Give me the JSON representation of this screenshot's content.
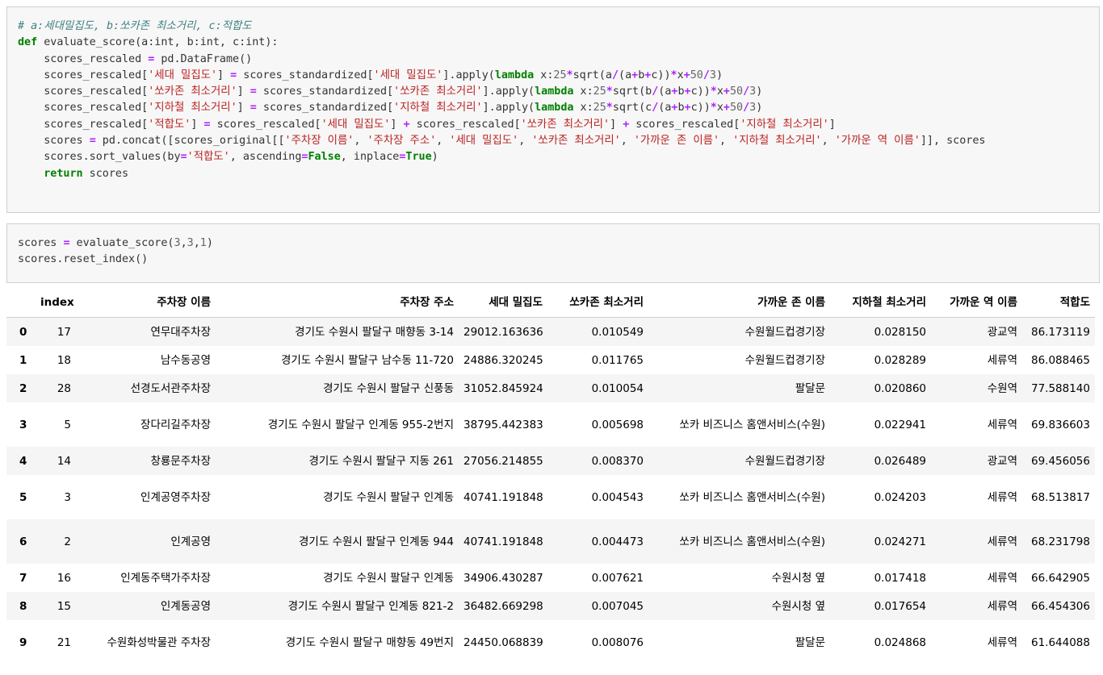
{
  "cell1": {
    "lines": [
      [
        {
          "t": "cm",
          "v": "# a:세대밀집도, b:쏘카존 최소거리, c:적합도"
        }
      ],
      [
        {
          "t": "kw",
          "v": "def"
        },
        {
          "t": "pl",
          "v": " evaluate_score(a:int, b:int, c:int):"
        }
      ],
      [
        {
          "t": "pl",
          "v": "    scores_rescaled "
        },
        {
          "t": "op",
          "v": "="
        },
        {
          "t": "pl",
          "v": " pd.DataFrame()"
        }
      ],
      [
        {
          "t": "pl",
          "v": "    scores_rescaled["
        },
        {
          "t": "st",
          "v": "'세대 밀집도'"
        },
        {
          "t": "pl",
          "v": "] "
        },
        {
          "t": "op",
          "v": "="
        },
        {
          "t": "pl",
          "v": " scores_standardized["
        },
        {
          "t": "st",
          "v": "'세대 밀집도'"
        },
        {
          "t": "pl",
          "v": "].apply("
        },
        {
          "t": "kw",
          "v": "lambda"
        },
        {
          "t": "pl",
          "v": " x:"
        },
        {
          "t": "nu",
          "v": "25"
        },
        {
          "t": "op",
          "v": "*"
        },
        {
          "t": "pl",
          "v": "sqrt(a"
        },
        {
          "t": "op",
          "v": "/"
        },
        {
          "t": "pl",
          "v": "(a"
        },
        {
          "t": "op",
          "v": "+"
        },
        {
          "t": "pl",
          "v": "b"
        },
        {
          "t": "op",
          "v": "+"
        },
        {
          "t": "pl",
          "v": "c))"
        },
        {
          "t": "op",
          "v": "*"
        },
        {
          "t": "pl",
          "v": "x"
        },
        {
          "t": "op",
          "v": "+"
        },
        {
          "t": "nu",
          "v": "50"
        },
        {
          "t": "op",
          "v": "/"
        },
        {
          "t": "nu",
          "v": "3"
        },
        {
          "t": "pl",
          "v": ")"
        }
      ],
      [
        {
          "t": "pl",
          "v": "    scores_rescaled["
        },
        {
          "t": "st",
          "v": "'쏘카존 최소거리'"
        },
        {
          "t": "pl",
          "v": "] "
        },
        {
          "t": "op",
          "v": "="
        },
        {
          "t": "pl",
          "v": " scores_standardized["
        },
        {
          "t": "st",
          "v": "'쏘카존 최소거리'"
        },
        {
          "t": "pl",
          "v": "].apply("
        },
        {
          "t": "kw",
          "v": "lambda"
        },
        {
          "t": "pl",
          "v": " x:"
        },
        {
          "t": "nu",
          "v": "25"
        },
        {
          "t": "op",
          "v": "*"
        },
        {
          "t": "pl",
          "v": "sqrt(b"
        },
        {
          "t": "op",
          "v": "/"
        },
        {
          "t": "pl",
          "v": "(a"
        },
        {
          "t": "op",
          "v": "+"
        },
        {
          "t": "pl",
          "v": "b"
        },
        {
          "t": "op",
          "v": "+"
        },
        {
          "t": "pl",
          "v": "c))"
        },
        {
          "t": "op",
          "v": "*"
        },
        {
          "t": "pl",
          "v": "x"
        },
        {
          "t": "op",
          "v": "+"
        },
        {
          "t": "nu",
          "v": "50"
        },
        {
          "t": "op",
          "v": "/"
        },
        {
          "t": "nu",
          "v": "3"
        },
        {
          "t": "pl",
          "v": ")"
        }
      ],
      [
        {
          "t": "pl",
          "v": "    scores_rescaled["
        },
        {
          "t": "st",
          "v": "'지하철 최소거리'"
        },
        {
          "t": "pl",
          "v": "] "
        },
        {
          "t": "op",
          "v": "="
        },
        {
          "t": "pl",
          "v": " scores_standardized["
        },
        {
          "t": "st",
          "v": "'지하철 최소거리'"
        },
        {
          "t": "pl",
          "v": "].apply("
        },
        {
          "t": "kw",
          "v": "lambda"
        },
        {
          "t": "pl",
          "v": " x:"
        },
        {
          "t": "nu",
          "v": "25"
        },
        {
          "t": "op",
          "v": "*"
        },
        {
          "t": "pl",
          "v": "sqrt(c"
        },
        {
          "t": "op",
          "v": "/"
        },
        {
          "t": "pl",
          "v": "(a"
        },
        {
          "t": "op",
          "v": "+"
        },
        {
          "t": "pl",
          "v": "b"
        },
        {
          "t": "op",
          "v": "+"
        },
        {
          "t": "pl",
          "v": "c))"
        },
        {
          "t": "op",
          "v": "*"
        },
        {
          "t": "pl",
          "v": "x"
        },
        {
          "t": "op",
          "v": "+"
        },
        {
          "t": "nu",
          "v": "50"
        },
        {
          "t": "op",
          "v": "/"
        },
        {
          "t": "nu",
          "v": "3"
        },
        {
          "t": "pl",
          "v": ")"
        }
      ],
      [
        {
          "t": "pl",
          "v": "    scores_rescaled["
        },
        {
          "t": "st",
          "v": "'적합도'"
        },
        {
          "t": "pl",
          "v": "] "
        },
        {
          "t": "op",
          "v": "="
        },
        {
          "t": "pl",
          "v": " scores_rescaled["
        },
        {
          "t": "st",
          "v": "'세대 밀집도'"
        },
        {
          "t": "pl",
          "v": "] "
        },
        {
          "t": "op",
          "v": "+"
        },
        {
          "t": "pl",
          "v": " scores_rescaled["
        },
        {
          "t": "st",
          "v": "'쏘카존 최소거리'"
        },
        {
          "t": "pl",
          "v": "] "
        },
        {
          "t": "op",
          "v": "+"
        },
        {
          "t": "pl",
          "v": " scores_rescaled["
        },
        {
          "t": "st",
          "v": "'지하철 최소거리'"
        },
        {
          "t": "pl",
          "v": "]"
        }
      ],
      [
        {
          "t": "pl",
          "v": "    scores "
        },
        {
          "t": "op",
          "v": "="
        },
        {
          "t": "pl",
          "v": " pd.concat([scores_original[["
        },
        {
          "t": "st",
          "v": "'주차장 이름'"
        },
        {
          "t": "pl",
          "v": ", "
        },
        {
          "t": "st",
          "v": "'주차장 주소'"
        },
        {
          "t": "pl",
          "v": ", "
        },
        {
          "t": "st",
          "v": "'세대 밀집도'"
        },
        {
          "t": "pl",
          "v": ", "
        },
        {
          "t": "st",
          "v": "'쏘카존 최소거리'"
        },
        {
          "t": "pl",
          "v": ", "
        },
        {
          "t": "st",
          "v": "'가까운 존 이름'"
        },
        {
          "t": "pl",
          "v": ", "
        },
        {
          "t": "st",
          "v": "'지하철 최소거리'"
        },
        {
          "t": "pl",
          "v": ", "
        },
        {
          "t": "st",
          "v": "'가까운 역 이름'"
        },
        {
          "t": "pl",
          "v": "]], scores"
        }
      ],
      [
        {
          "t": "pl",
          "v": "    scores.sort_values(by"
        },
        {
          "t": "op",
          "v": "="
        },
        {
          "t": "st",
          "v": "'적합도'"
        },
        {
          "t": "pl",
          "v": ", ascending"
        },
        {
          "t": "op",
          "v": "="
        },
        {
          "t": "kw",
          "v": "False"
        },
        {
          "t": "pl",
          "v": ", inplace"
        },
        {
          "t": "op",
          "v": "="
        },
        {
          "t": "kw",
          "v": "True"
        },
        {
          "t": "pl",
          "v": ")"
        }
      ],
      [
        {
          "t": "pl",
          "v": "    "
        },
        {
          "t": "kw",
          "v": "return"
        },
        {
          "t": "pl",
          "v": " scores"
        }
      ]
    ]
  },
  "cell2": {
    "lines": [
      [
        {
          "t": "pl",
          "v": "scores "
        },
        {
          "t": "op",
          "v": "="
        },
        {
          "t": "pl",
          "v": " evaluate_score("
        },
        {
          "t": "nu",
          "v": "3"
        },
        {
          "t": "pl",
          "v": ","
        },
        {
          "t": "nu",
          "v": "3"
        },
        {
          "t": "pl",
          "v": ","
        },
        {
          "t": "nu",
          "v": "1"
        },
        {
          "t": "pl",
          "v": ")"
        }
      ],
      [
        {
          "t": "pl",
          "v": "scores.reset_index()"
        }
      ]
    ]
  },
  "table": {
    "headers": [
      "",
      "index",
      "주차장 이름",
      "주차장 주소",
      "세대 밀집도",
      "쏘카존 최소거리",
      "가까운 존 이름",
      "지하철 최소거리",
      "가까운 역 이름",
      "적합도"
    ],
    "rows": [
      [
        "0",
        "17",
        "연무대주차장",
        "경기도 수원시 팔달구 매향동 3-14",
        "29012.163636",
        "0.010549",
        "수원월드컵경기장",
        "0.028150",
        "광교역",
        "86.173119"
      ],
      [
        "1",
        "18",
        "남수동공영",
        "경기도 수원시 팔달구 남수동 11-720",
        "24886.320245",
        "0.011765",
        "수원월드컵경기장",
        "0.028289",
        "세류역",
        "86.088465"
      ],
      [
        "2",
        "28",
        "선경도서관주차장",
        "경기도 수원시 팔달구 신풍동",
        "31052.845924",
        "0.010054",
        "팔달문",
        "0.020860",
        "수원역",
        "77.588140"
      ],
      [
        "3",
        "5",
        "장다리길주차장",
        "경기도 수원시 팔달구 인계동 955-2번지",
        "38795.442383",
        "0.005698",
        "쏘카 비즈니스 홈앤서비스(수원)",
        "0.022941",
        "세류역",
        "69.836603"
      ],
      [
        "4",
        "14",
        "창룡문주차장",
        "경기도 수원시 팔달구 지동 261",
        "27056.214855",
        "0.008370",
        "수원월드컵경기장",
        "0.026489",
        "광교역",
        "69.456056"
      ],
      [
        "5",
        "3",
        "인계공영주차장",
        "경기도 수원시 팔달구 인계동",
        "40741.191848",
        "0.004543",
        "쏘카 비즈니스 홈앤서비스(수원)",
        "0.024203",
        "세류역",
        "68.513817"
      ],
      [
        "6",
        "2",
        "인계공영",
        "경기도 수원시 팔달구 인계동 944",
        "40741.191848",
        "0.004473",
        "쏘카 비즈니스 홈앤서비스(수원)",
        "0.024271",
        "세류역",
        "68.231798"
      ],
      [
        "7",
        "16",
        "인계동주택가주차장",
        "경기도 수원시 팔달구 인계동",
        "34906.430287",
        "0.007621",
        "수원시청 옆",
        "0.017418",
        "세류역",
        "66.642905"
      ],
      [
        "8",
        "15",
        "인계동공영",
        "경기도 수원시 팔달구 인계동 821-2",
        "36482.669298",
        "0.007045",
        "수원시청 옆",
        "0.017654",
        "세류역",
        "66.454306"
      ],
      [
        "9",
        "21",
        "수원화성박물관 주차장",
        "경기도 수원시 팔달구 매향동 49번지",
        "24450.068839",
        "0.008076",
        "팔달문",
        "0.024868",
        "세류역",
        "61.644088"
      ]
    ]
  }
}
